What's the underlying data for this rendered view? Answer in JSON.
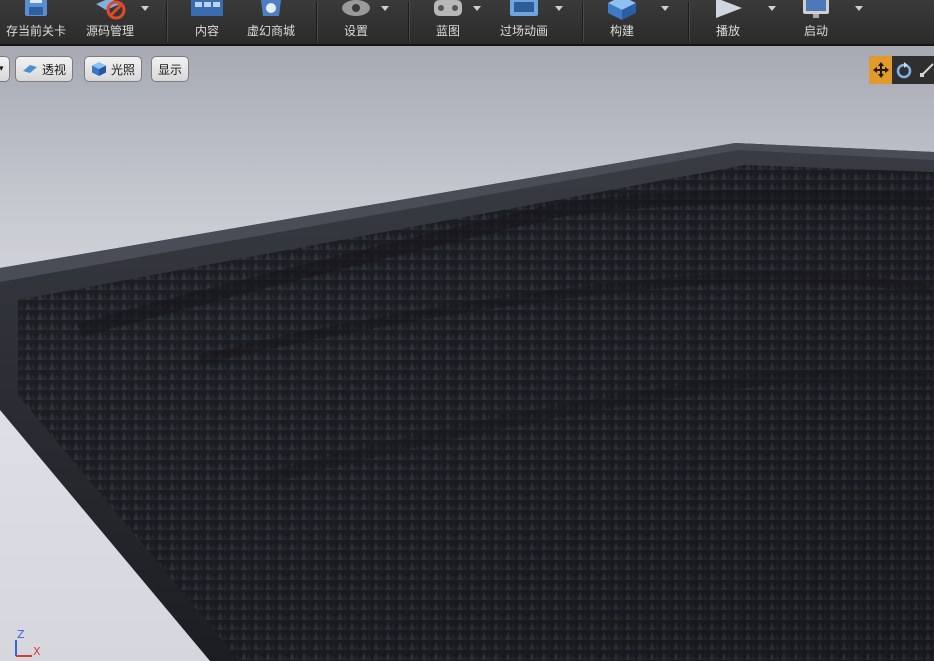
{
  "toolbar": {
    "items": [
      {
        "label": "存当前关卡",
        "icon": "save-icon"
      },
      {
        "label": "源码管理",
        "icon": "source-control-icon"
      },
      {
        "label": "内容",
        "icon": "content-browser-icon"
      },
      {
        "label": "虚幻商城",
        "icon": "marketplace-icon"
      },
      {
        "label": "设置",
        "icon": "settings-icon"
      },
      {
        "label": "蓝图",
        "icon": "blueprint-icon"
      },
      {
        "label": "过场动画",
        "icon": "cinematics-icon"
      },
      {
        "label": "构建",
        "icon": "build-icon"
      },
      {
        "label": "播放",
        "icon": "play-icon"
      },
      {
        "label": "启动",
        "icon": "launch-icon"
      }
    ]
  },
  "viewport": {
    "perspective_label": "透视",
    "lighting_label": "光照",
    "show_label": "显示",
    "axis": {
      "z": "Z",
      "x": "X"
    }
  },
  "colors": {
    "toolbar_bg": "#2b2b2b",
    "accent_orange": "#e29a2a",
    "terrain": "#24262d",
    "sky": "#dfe0e7"
  }
}
